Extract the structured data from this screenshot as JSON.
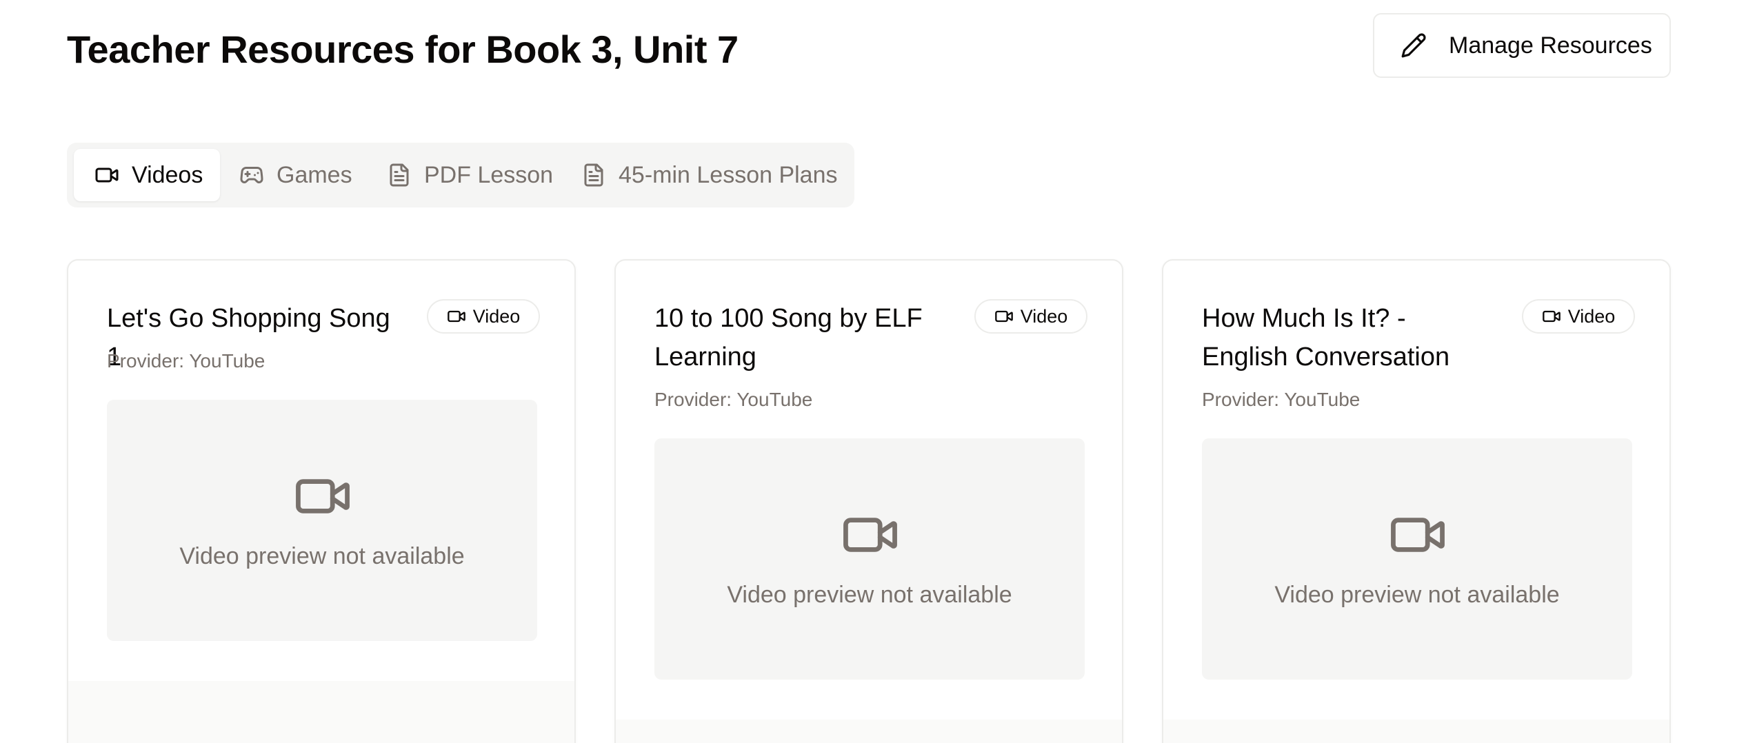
{
  "header": {
    "title": "Teacher Resources for Book 3, Unit 7",
    "manage_label": "Manage Resources"
  },
  "tabs": [
    {
      "label": "Videos",
      "icon": "video-icon",
      "active": true
    },
    {
      "label": "Games",
      "icon": "gamepad-icon",
      "active": false
    },
    {
      "label": "PDF Lesson",
      "icon": "file-text-icon",
      "active": false
    },
    {
      "label": "45-min Lesson Plans",
      "icon": "file-text-icon",
      "active": false
    }
  ],
  "cards": [
    {
      "title": "Let's Go Shopping Song 1",
      "badge": "Video",
      "provider": "Provider: YouTube",
      "preview_text": "Video preview not available"
    },
    {
      "title": "10 to 100 Song by ELF Learning",
      "badge": "Video",
      "provider": "Provider: YouTube",
      "preview_text": "Video preview not available"
    },
    {
      "title": "How Much Is It? - English Conversation",
      "badge": "Video",
      "provider": "Provider: YouTube",
      "preview_text": "Video preview not available"
    }
  ],
  "colors": {
    "text": "#0c0a09",
    "muted": "#78716c",
    "surface": "#f5f5f4",
    "border": "#ececea"
  }
}
